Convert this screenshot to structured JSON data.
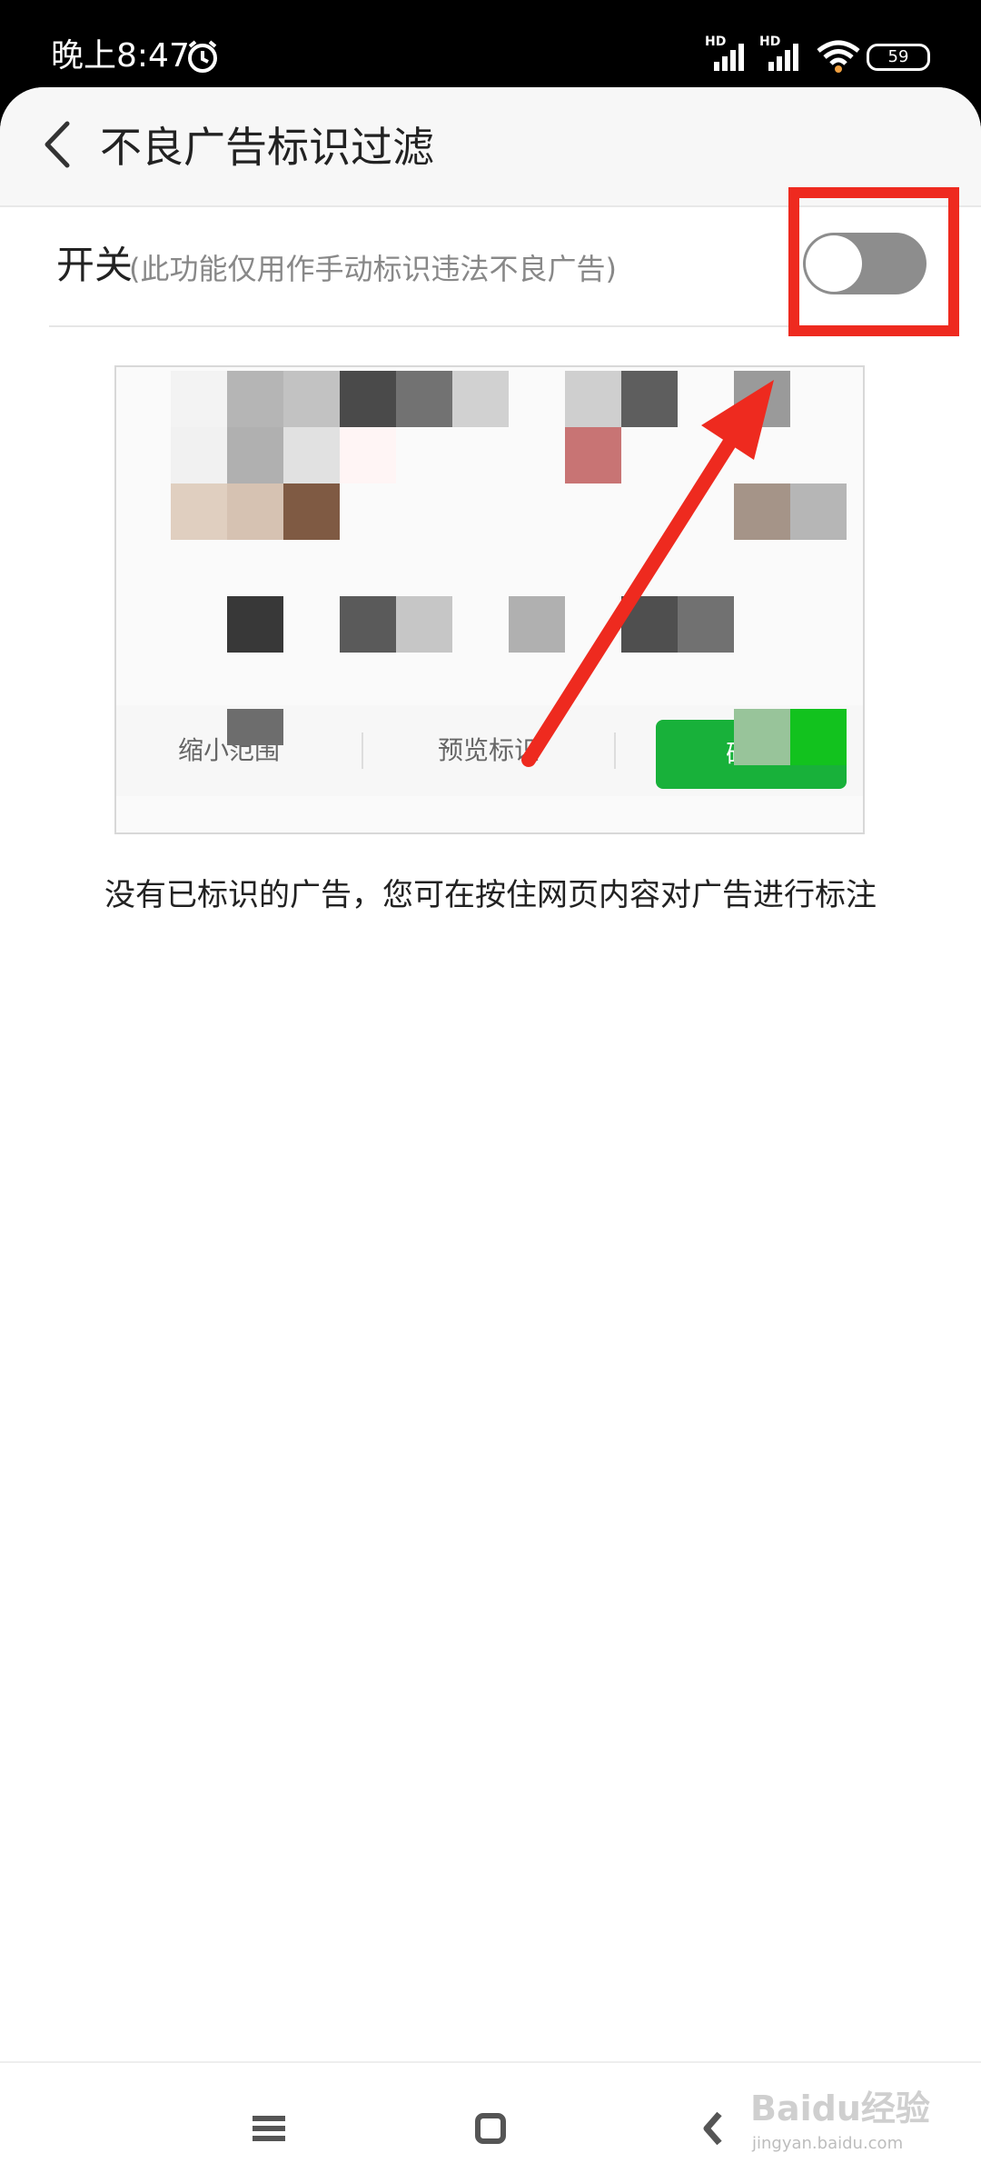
{
  "status_bar": {
    "time": "晚上8:47",
    "signal1_label": "HD",
    "signal2_label": "HD",
    "battery": "59",
    "icons": [
      "alarm-icon",
      "signal-icon",
      "signal-icon",
      "wifi-icon",
      "battery-icon"
    ]
  },
  "header": {
    "title": "不良广告标识过滤",
    "back_icon": "chevron-left-icon"
  },
  "switch_row": {
    "label": "开关",
    "description": "(此功能仅用作手动标识违法不良广告)",
    "enabled": false
  },
  "preview": {
    "actions": [
      "缩小范围",
      "预览标识"
    ],
    "confirm_label": "确认",
    "colors": {
      "confirm": "#18b13a"
    }
  },
  "empty_hint": "没有已标识的广告，您可在按住网页内容对广告进行标注",
  "nav": {
    "icons": [
      "menu-icon",
      "home-icon",
      "back-icon"
    ]
  },
  "watermark": {
    "text": "Baidu经验",
    "sub": "jingyan.baidu.com"
  },
  "colors": {
    "accent_red": "#ee2a1f",
    "toggle_off": "#8d8d8d"
  }
}
